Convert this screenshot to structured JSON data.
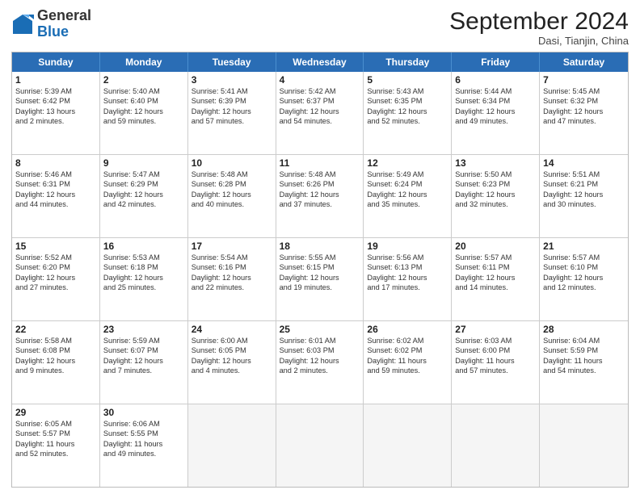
{
  "logo": {
    "line1": "General",
    "line2": "Blue"
  },
  "title": "September 2024",
  "subtitle": "Dasi, Tianjin, China",
  "weekdays": [
    "Sunday",
    "Monday",
    "Tuesday",
    "Wednesday",
    "Thursday",
    "Friday",
    "Saturday"
  ],
  "weeks": [
    [
      {
        "day": "1",
        "lines": [
          "Sunrise: 5:39 AM",
          "Sunset: 6:42 PM",
          "Daylight: 13 hours",
          "and 2 minutes."
        ]
      },
      {
        "day": "2",
        "lines": [
          "Sunrise: 5:40 AM",
          "Sunset: 6:40 PM",
          "Daylight: 12 hours",
          "and 59 minutes."
        ]
      },
      {
        "day": "3",
        "lines": [
          "Sunrise: 5:41 AM",
          "Sunset: 6:39 PM",
          "Daylight: 12 hours",
          "and 57 minutes."
        ]
      },
      {
        "day": "4",
        "lines": [
          "Sunrise: 5:42 AM",
          "Sunset: 6:37 PM",
          "Daylight: 12 hours",
          "and 54 minutes."
        ]
      },
      {
        "day": "5",
        "lines": [
          "Sunrise: 5:43 AM",
          "Sunset: 6:35 PM",
          "Daylight: 12 hours",
          "and 52 minutes."
        ]
      },
      {
        "day": "6",
        "lines": [
          "Sunrise: 5:44 AM",
          "Sunset: 6:34 PM",
          "Daylight: 12 hours",
          "and 49 minutes."
        ]
      },
      {
        "day": "7",
        "lines": [
          "Sunrise: 5:45 AM",
          "Sunset: 6:32 PM",
          "Daylight: 12 hours",
          "and 47 minutes."
        ]
      }
    ],
    [
      {
        "day": "8",
        "lines": [
          "Sunrise: 5:46 AM",
          "Sunset: 6:31 PM",
          "Daylight: 12 hours",
          "and 44 minutes."
        ]
      },
      {
        "day": "9",
        "lines": [
          "Sunrise: 5:47 AM",
          "Sunset: 6:29 PM",
          "Daylight: 12 hours",
          "and 42 minutes."
        ]
      },
      {
        "day": "10",
        "lines": [
          "Sunrise: 5:48 AM",
          "Sunset: 6:28 PM",
          "Daylight: 12 hours",
          "and 40 minutes."
        ]
      },
      {
        "day": "11",
        "lines": [
          "Sunrise: 5:48 AM",
          "Sunset: 6:26 PM",
          "Daylight: 12 hours",
          "and 37 minutes."
        ]
      },
      {
        "day": "12",
        "lines": [
          "Sunrise: 5:49 AM",
          "Sunset: 6:24 PM",
          "Daylight: 12 hours",
          "and 35 minutes."
        ]
      },
      {
        "day": "13",
        "lines": [
          "Sunrise: 5:50 AM",
          "Sunset: 6:23 PM",
          "Daylight: 12 hours",
          "and 32 minutes."
        ]
      },
      {
        "day": "14",
        "lines": [
          "Sunrise: 5:51 AM",
          "Sunset: 6:21 PM",
          "Daylight: 12 hours",
          "and 30 minutes."
        ]
      }
    ],
    [
      {
        "day": "15",
        "lines": [
          "Sunrise: 5:52 AM",
          "Sunset: 6:20 PM",
          "Daylight: 12 hours",
          "and 27 minutes."
        ]
      },
      {
        "day": "16",
        "lines": [
          "Sunrise: 5:53 AM",
          "Sunset: 6:18 PM",
          "Daylight: 12 hours",
          "and 25 minutes."
        ]
      },
      {
        "day": "17",
        "lines": [
          "Sunrise: 5:54 AM",
          "Sunset: 6:16 PM",
          "Daylight: 12 hours",
          "and 22 minutes."
        ]
      },
      {
        "day": "18",
        "lines": [
          "Sunrise: 5:55 AM",
          "Sunset: 6:15 PM",
          "Daylight: 12 hours",
          "and 19 minutes."
        ]
      },
      {
        "day": "19",
        "lines": [
          "Sunrise: 5:56 AM",
          "Sunset: 6:13 PM",
          "Daylight: 12 hours",
          "and 17 minutes."
        ]
      },
      {
        "day": "20",
        "lines": [
          "Sunrise: 5:57 AM",
          "Sunset: 6:11 PM",
          "Daylight: 12 hours",
          "and 14 minutes."
        ]
      },
      {
        "day": "21",
        "lines": [
          "Sunrise: 5:57 AM",
          "Sunset: 6:10 PM",
          "Daylight: 12 hours",
          "and 12 minutes."
        ]
      }
    ],
    [
      {
        "day": "22",
        "lines": [
          "Sunrise: 5:58 AM",
          "Sunset: 6:08 PM",
          "Daylight: 12 hours",
          "and 9 minutes."
        ]
      },
      {
        "day": "23",
        "lines": [
          "Sunrise: 5:59 AM",
          "Sunset: 6:07 PM",
          "Daylight: 12 hours",
          "and 7 minutes."
        ]
      },
      {
        "day": "24",
        "lines": [
          "Sunrise: 6:00 AM",
          "Sunset: 6:05 PM",
          "Daylight: 12 hours",
          "and 4 minutes."
        ]
      },
      {
        "day": "25",
        "lines": [
          "Sunrise: 6:01 AM",
          "Sunset: 6:03 PM",
          "Daylight: 12 hours",
          "and 2 minutes."
        ]
      },
      {
        "day": "26",
        "lines": [
          "Sunrise: 6:02 AM",
          "Sunset: 6:02 PM",
          "Daylight: 11 hours",
          "and 59 minutes."
        ]
      },
      {
        "day": "27",
        "lines": [
          "Sunrise: 6:03 AM",
          "Sunset: 6:00 PM",
          "Daylight: 11 hours",
          "and 57 minutes."
        ]
      },
      {
        "day": "28",
        "lines": [
          "Sunrise: 6:04 AM",
          "Sunset: 5:59 PM",
          "Daylight: 11 hours",
          "and 54 minutes."
        ]
      }
    ],
    [
      {
        "day": "29",
        "lines": [
          "Sunrise: 6:05 AM",
          "Sunset: 5:57 PM",
          "Daylight: 11 hours",
          "and 52 minutes."
        ]
      },
      {
        "day": "30",
        "lines": [
          "Sunrise: 6:06 AM",
          "Sunset: 5:55 PM",
          "Daylight: 11 hours",
          "and 49 minutes."
        ]
      },
      {
        "day": "",
        "lines": []
      },
      {
        "day": "",
        "lines": []
      },
      {
        "day": "",
        "lines": []
      },
      {
        "day": "",
        "lines": []
      },
      {
        "day": "",
        "lines": []
      }
    ]
  ]
}
